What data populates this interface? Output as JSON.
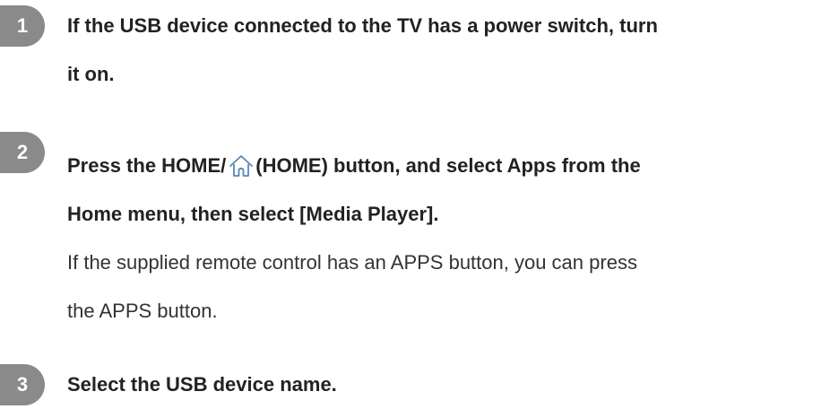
{
  "steps": [
    {
      "number": "1",
      "lines": [
        "If the USB device connected to the TV has a power switch, turn",
        "it on."
      ]
    },
    {
      "number": "2",
      "line1_before": "Press the HOME/",
      "line1_icon": "home-icon",
      "line1_after": "(HOME) button, and select Apps from the",
      "line2": "Home menu, then select [Media Player].",
      "note_lines": [
        "If the supplied remote control has an APPS button, you can press",
        "the APPS button."
      ]
    },
    {
      "number": "3",
      "lines": [
        "Select the USB device name."
      ]
    }
  ],
  "colors": {
    "badge": "#8a8a8a",
    "text": "#222222"
  }
}
